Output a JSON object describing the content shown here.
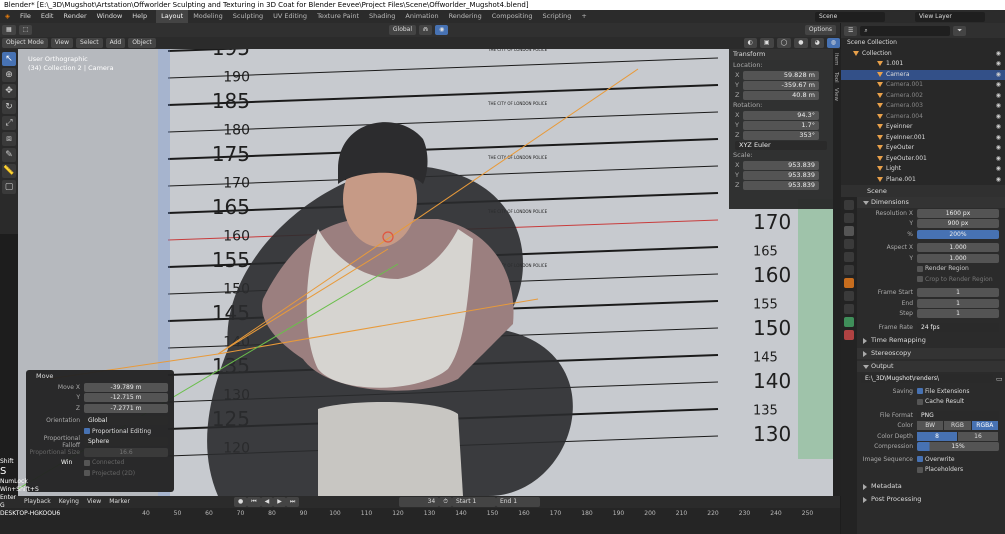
{
  "titlebar": {
    "title": "Blender* [E:\\_3D\\Mugshot\\Artstation\\Offworlder Sculpting and Texturing in 3D Coat for Blender Eevee\\Project Files\\Scene\\Offworlder_Mugshot4.blend]"
  },
  "menu": [
    "File",
    "Edit",
    "Render",
    "Window",
    "Help"
  ],
  "workspaces": [
    "Layout",
    "Modeling",
    "Sculpting",
    "UV Editing",
    "Texture Paint",
    "Shading",
    "Animation",
    "Rendering",
    "Compositing",
    "Scripting"
  ],
  "scene_name": "Scene",
  "view_layer": "View Layer",
  "header": {
    "mode": "Object Mode",
    "view": "View",
    "select": "Select",
    "add": "Add",
    "object": "Object",
    "orientation": "Global",
    "options": "Options"
  },
  "viewport": {
    "line1": "User Orthographic",
    "line2": "(34) Collection 2 | Camera",
    "height_left": [
      "195",
      "190",
      "185",
      "180",
      "175",
      "170",
      "165",
      "160",
      "155",
      "150",
      "145",
      "140",
      "135",
      "130",
      "125",
      "120"
    ],
    "height_right": [
      "170",
      "165",
      "160",
      "155",
      "150",
      "145",
      "140",
      "135",
      "130"
    ],
    "board_text": "THE CITY OF LONDON POLICE"
  },
  "npanel": {
    "title": "Transform",
    "location_label": "Location:",
    "location": [
      "59.828 m",
      "-359.67 m",
      "40.8 m"
    ],
    "rotation_label": "Rotation:",
    "rotation": [
      "94.3°",
      "1.7°",
      "353°"
    ],
    "euler": "XYZ Euler",
    "scale_label": "Scale:",
    "scale": [
      "953.839",
      "953.839",
      "953.839"
    ],
    "axes": [
      "X",
      "Y",
      "Z"
    ],
    "tabs": [
      "Item",
      "Tool",
      "View"
    ]
  },
  "move_panel": {
    "title": "Move",
    "move_x_label": "Move X",
    "move_x": "-39.789 m",
    "y_label": "Y",
    "y": "-12.715 m",
    "z_label": "Z",
    "z": "-7.2771 m",
    "orientation_label": "Orientation",
    "orientation": "Global",
    "prop_edit": "Proportional Editing",
    "falloff_label": "Proportional Falloff",
    "falloff": "Sphere",
    "prop_size_label": "Proportional Size",
    "prop_size": "16.6",
    "connected": "Connected",
    "projected": "Projected (2D)"
  },
  "keys": {
    "shift": "Shift",
    "s": "S",
    "win": "Win",
    "numlock": "NumLock",
    "combo": "Win+Shift+S",
    "enter": "Enter",
    "g": "G",
    "machine": "DESKTOP-HGKOOU6"
  },
  "timeline": {
    "menu": [
      "Playback",
      "Keying",
      "View",
      "Marker"
    ],
    "frame": "34",
    "start_label": "Start",
    "start": "1",
    "end_label": "End",
    "end": "1",
    "ticks": [
      "40",
      "50",
      "60",
      "70",
      "80",
      "90",
      "100",
      "110",
      "120",
      "130",
      "140",
      "150",
      "160",
      "170",
      "180",
      "190",
      "200",
      "210",
      "220",
      "230",
      "240",
      "250"
    ]
  },
  "outliner": {
    "root": "Scene Collection",
    "items": [
      {
        "name": "Collection",
        "sel": false
      },
      {
        "name": "1.001",
        "sel": false
      },
      {
        "name": "Camera",
        "sel": true
      },
      {
        "name": "Camera.001",
        "sel": false
      },
      {
        "name": "Camera.002",
        "sel": false
      },
      {
        "name": "Camera.003",
        "sel": false
      },
      {
        "name": "Camera.004",
        "sel": false
      },
      {
        "name": "Eyeinner",
        "sel": false
      },
      {
        "name": "EyeInner.001",
        "sel": false
      },
      {
        "name": "EyeOuter",
        "sel": false
      },
      {
        "name": "EyeOuter.001",
        "sel": false
      },
      {
        "name": "Light",
        "sel": false
      },
      {
        "name": "Plane.001",
        "sel": false
      }
    ]
  },
  "props": {
    "scene": "Scene",
    "dimensions": "Dimensions",
    "res_x_label": "Resolution X",
    "res_x": "1600 px",
    "res_y_label": "Y",
    "res_y": "900 px",
    "pct_label": "%",
    "pct": "200%",
    "aspect_x_label": "Aspect X",
    "aspect_x": "1.000",
    "aspect_y_label": "Y",
    "aspect_y": "1.000",
    "render_region": "Render Region",
    "crop": "Crop to Render Region",
    "frame_start_label": "Frame Start",
    "frame_start": "1",
    "end_label": "End",
    "end": "1",
    "step_label": "Step",
    "step": "1",
    "frame_rate_label": "Frame Rate",
    "frame_rate": "24 fps",
    "time_remap": "Time Remapping",
    "stereoscopy": "Stereoscopy",
    "output": "Output",
    "output_path": "E:\\_3D\\Mugshot\\renders\\",
    "saving_label": "Saving",
    "file_ext": "File Extensions",
    "cache_result": "Cache Result",
    "file_format_label": "File Format",
    "file_format": "PNG",
    "color_label": "Color",
    "color_opts": [
      "BW",
      "RGB",
      "RGBA"
    ],
    "depth_label": "Color Depth",
    "depth_opts": [
      "8",
      "16"
    ],
    "compression_label": "Compression",
    "compression": "15%",
    "img_seq_label": "Image Sequence",
    "overwrite": "Overwrite",
    "placeholders": "Placeholders",
    "metadata": "Metadata",
    "post_processing": "Post Processing"
  }
}
